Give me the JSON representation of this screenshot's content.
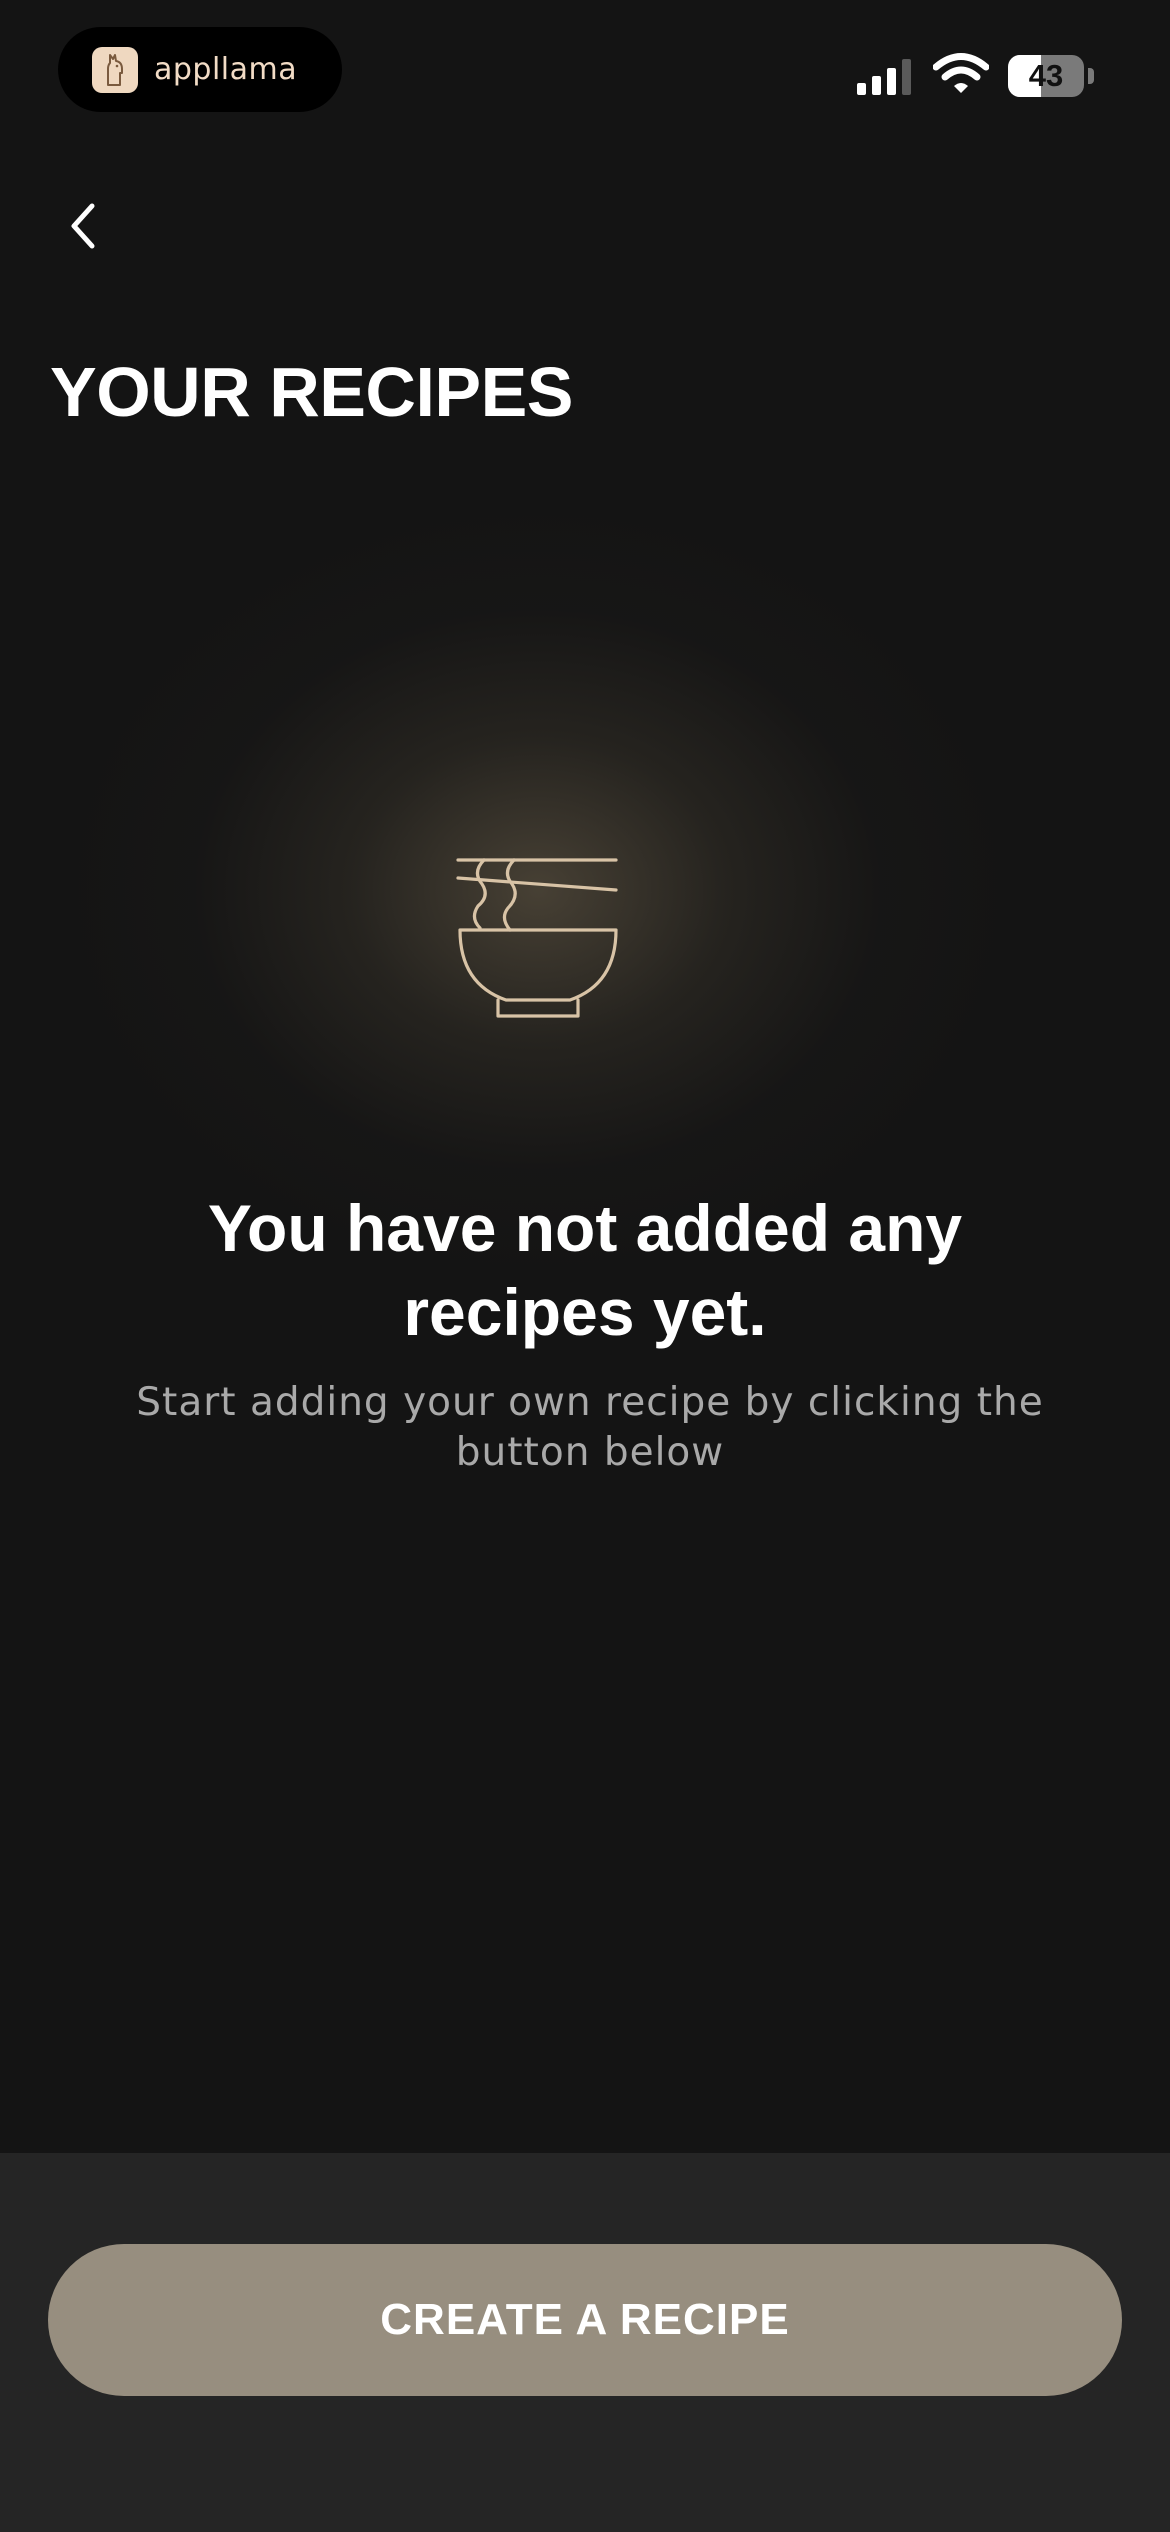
{
  "status_bar": {
    "app_name": "appllama",
    "battery": "43",
    "battery_level_percent": 43,
    "icons": [
      "cellular-signal-icon",
      "wifi-icon",
      "battery-icon"
    ]
  },
  "nav": {
    "back_icon": "chevron-left-icon"
  },
  "page": {
    "title": "YOUR RECIPES"
  },
  "empty_state": {
    "icon": "noodle-bowl-icon",
    "title": "You have not added any recipes yet.",
    "subtitle": "Start adding your own recipe by clicking the button below"
  },
  "actions": {
    "create_label": "CREATE A RECIPE"
  },
  "colors": {
    "background": "#141414",
    "bottom_bar": "#252525",
    "button": "#978e7f",
    "icon_stroke": "#d8c3a6",
    "subtitle": "#a9a9a9"
  }
}
